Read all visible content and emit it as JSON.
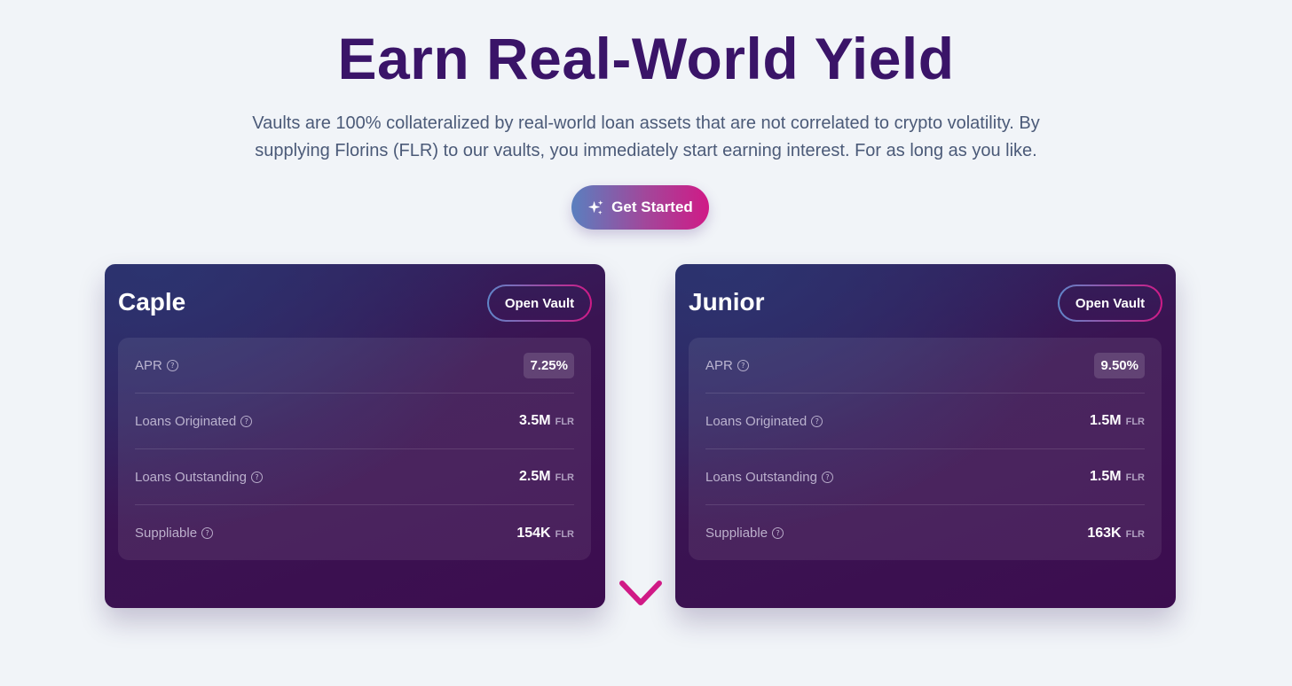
{
  "hero": {
    "title": "Earn Real-World Yield",
    "subtitle": "Vaults are 100% collateralized by real-world loan assets that are not correlated to crypto volatility. By supplying Florins (FLR) to our vaults, you immediately start earning interest. For as long as you like.",
    "cta_label": "Get Started",
    "cta_icon": "sparkles-icon"
  },
  "colors": {
    "title": "#3a1468",
    "accent_pink": "#d01a86",
    "accent_blue": "#5a7fbf",
    "card_bg": "#3a1452",
    "page_bg": "#f1f4f8"
  },
  "vaults": [
    {
      "name": "Caple",
      "open_label": "Open Vault",
      "stats": {
        "apr_label": "APR",
        "apr_value": "7.25%",
        "originated_label": "Loans Originated",
        "originated_value": "3.5M",
        "outstanding_label": "Loans Outstanding",
        "outstanding_value": "2.5M",
        "suppliable_label": "Suppliable",
        "suppliable_value": "154K",
        "unit": "FLR"
      }
    },
    {
      "name": "Junior",
      "open_label": "Open Vault",
      "stats": {
        "apr_label": "APR",
        "apr_value": "9.50%",
        "originated_label": "Loans Originated",
        "originated_value": "1.5M",
        "outstanding_label": "Loans Outstanding",
        "outstanding_value": "1.5M",
        "suppliable_label": "Suppliable",
        "suppliable_value": "163K",
        "unit": "FLR"
      }
    }
  ],
  "help_glyph": "?",
  "scroll_icon": "chevron-down-icon"
}
